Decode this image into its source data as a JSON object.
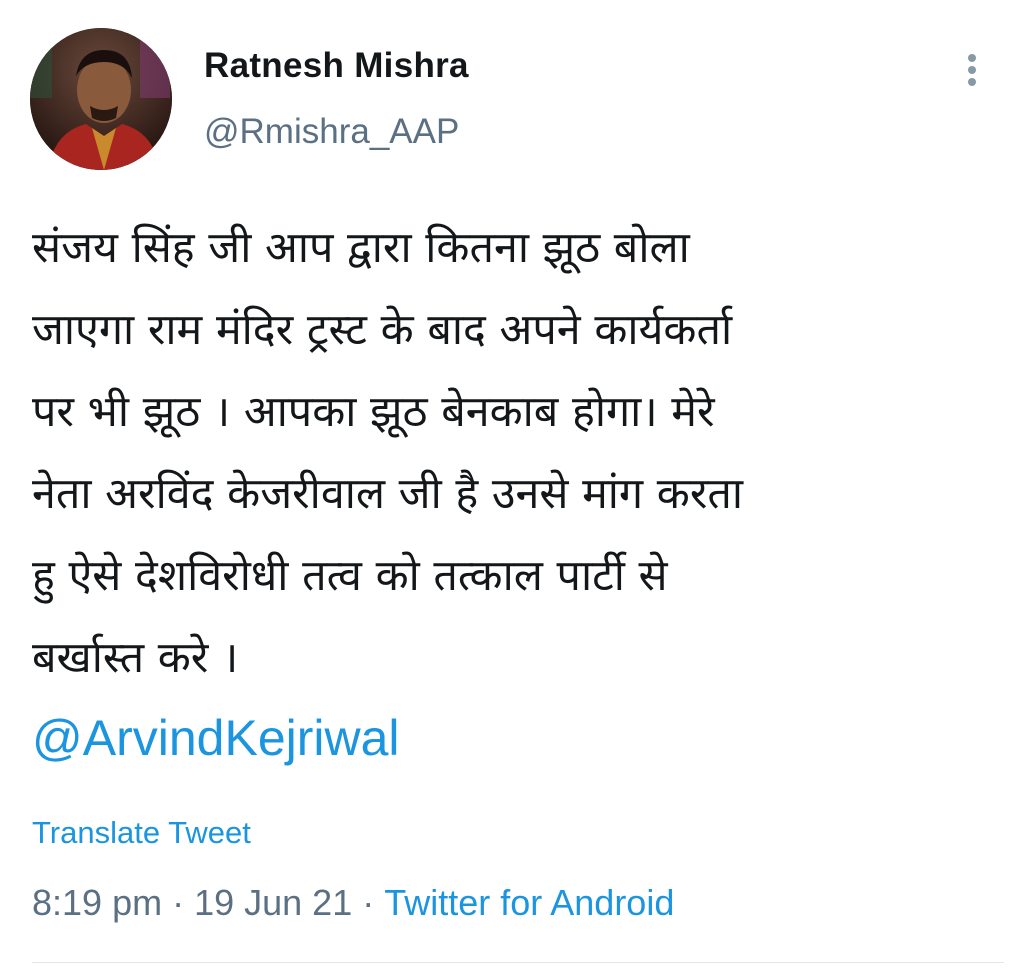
{
  "author": {
    "name": "Ratnesh Mishra",
    "handle": "@Rmishra_AAP"
  },
  "tweet": {
    "lines": [
      "संजय सिंह जी आप द्वारा कितना झूठ बोला",
      "जाएगा राम मंदिर ट्रस्ट के बाद अपने कार्यकर्ता",
      "पर भी झूठ । आपका झूठ बेनकाब होगा। मेरे",
      "नेता अरविंद केजरीवाल जी है उनसे मांग करता",
      "हु ऐसे देशविरोधी तत्व को तत्काल पार्टी से",
      "बर्खास्त करे ।"
    ],
    "mention": "@ArvindKejriwal"
  },
  "actions": {
    "translate_label": "Translate Tweet",
    "more_icon": "more-vertical-icon"
  },
  "meta": {
    "time": "8:19 pm",
    "separator": "·",
    "date": "19 Jun 21",
    "source": "Twitter for Android"
  },
  "colors": {
    "link": "#1b95e0",
    "secondary_text": "#5b7083",
    "primary_text": "#14171a",
    "divider": "#e1e8ed"
  }
}
